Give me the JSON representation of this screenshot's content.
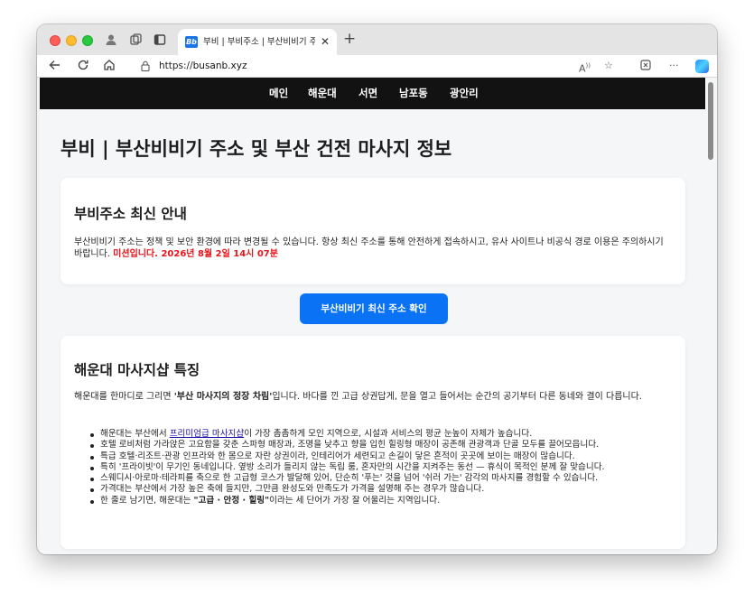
{
  "browser": {
    "tab_title": "부비 | 부비주소 | 부산비비기 주소 안내",
    "tab_favicon_text": "Bb",
    "url_scheme": "https://",
    "url_host": "busanb.xyz",
    "icons": {
      "back": "back-arrow-icon",
      "refresh": "refresh-icon",
      "home": "home-icon",
      "lock": "lock-icon",
      "read_aloud": "read-aloud-icon",
      "favorite": "star-icon",
      "extensions": "extensions-icon",
      "more": "more-icon",
      "copilot": "copilot-icon"
    }
  },
  "site_nav": {
    "items": [
      "메인",
      "해운대",
      "서면",
      "남포동",
      "광안리"
    ]
  },
  "page": {
    "title": "부비 | 부산비비기 주소 및 부산 건전 마사지 정보"
  },
  "notice_card": {
    "heading": "부비주소 최신 안내",
    "body": "부산비비기 주소는 정책 및 보안 환경에 따라 변경될 수 있습니다. 항상 최신 주소를 통해 안전하게 접속하시고, 유사 사이트나 비공식 경로 이용은 주의하시기 바랍니다.",
    "alert": "미션입니다. 2026년 8월 2일 14시 07분"
  },
  "cta": {
    "label": "부산비비기 최신 주소 확인"
  },
  "feature_card": {
    "heading": "해운대 마사지샵 특징",
    "intro_pre": "해운대를 한마디로 그리면 ",
    "intro_bold": "'부산 마사지의 정장 차림'",
    "intro_post": "입니다. 바다를 낀 고급 상권답게, 문을 열고 들어서는 순간의 공기부터 다른 동네와 결이 다릅니다.",
    "item1_pre": "해운대는 부산에서 ",
    "item1_link": "프리미엄급 마사지샵",
    "item1_post": "이 가장 촘촘하게 모인 지역으로, 시설과 서비스의 평균 눈높이 자체가 높습니다.",
    "items": [
      "호텔 로비처럼 가라앉은 고요함을 갖춘 스파형 매장과, 조명을 낮추고 향을 입힌 힐링형 매장이 공존해 관광객과 단골 모두를 끌어모읍니다.",
      "특급 호텔·리조트·관광 인프라와 한 몸으로 자란 상권이라, 인테리어가 세련되고 손길이 닿은 흔적이 곳곳에 보이는 매장이 많습니다.",
      "특히 '프라이빗'이 무기인 동네입니다. 옆방 소리가 들리지 않는 독립 룸, 혼자만의 시간을 지켜주는 동선 — 휴식이 목적인 분께 잘 맞습니다.",
      "스웨디시·아로마·테라피를 축으로 한 고급형 코스가 발달해 있어, 단순히 '푸는' 것을 넘어 '쉬러 가는' 감각의 마사지를 경험할 수 있습니다.",
      "가격대는 부산에서 가장 높은 축에 들지만, 그만큼 완성도와 만족도가 가격을 설명해 주는 경우가 많습니다."
    ],
    "last_pre": "한 줄로 남기면, 해운대는 ",
    "last_bold": "\"고급 · 안정 · 힐링\"",
    "last_post": "이라는 세 단어가 가장 잘 어울리는 지역입니다."
  }
}
